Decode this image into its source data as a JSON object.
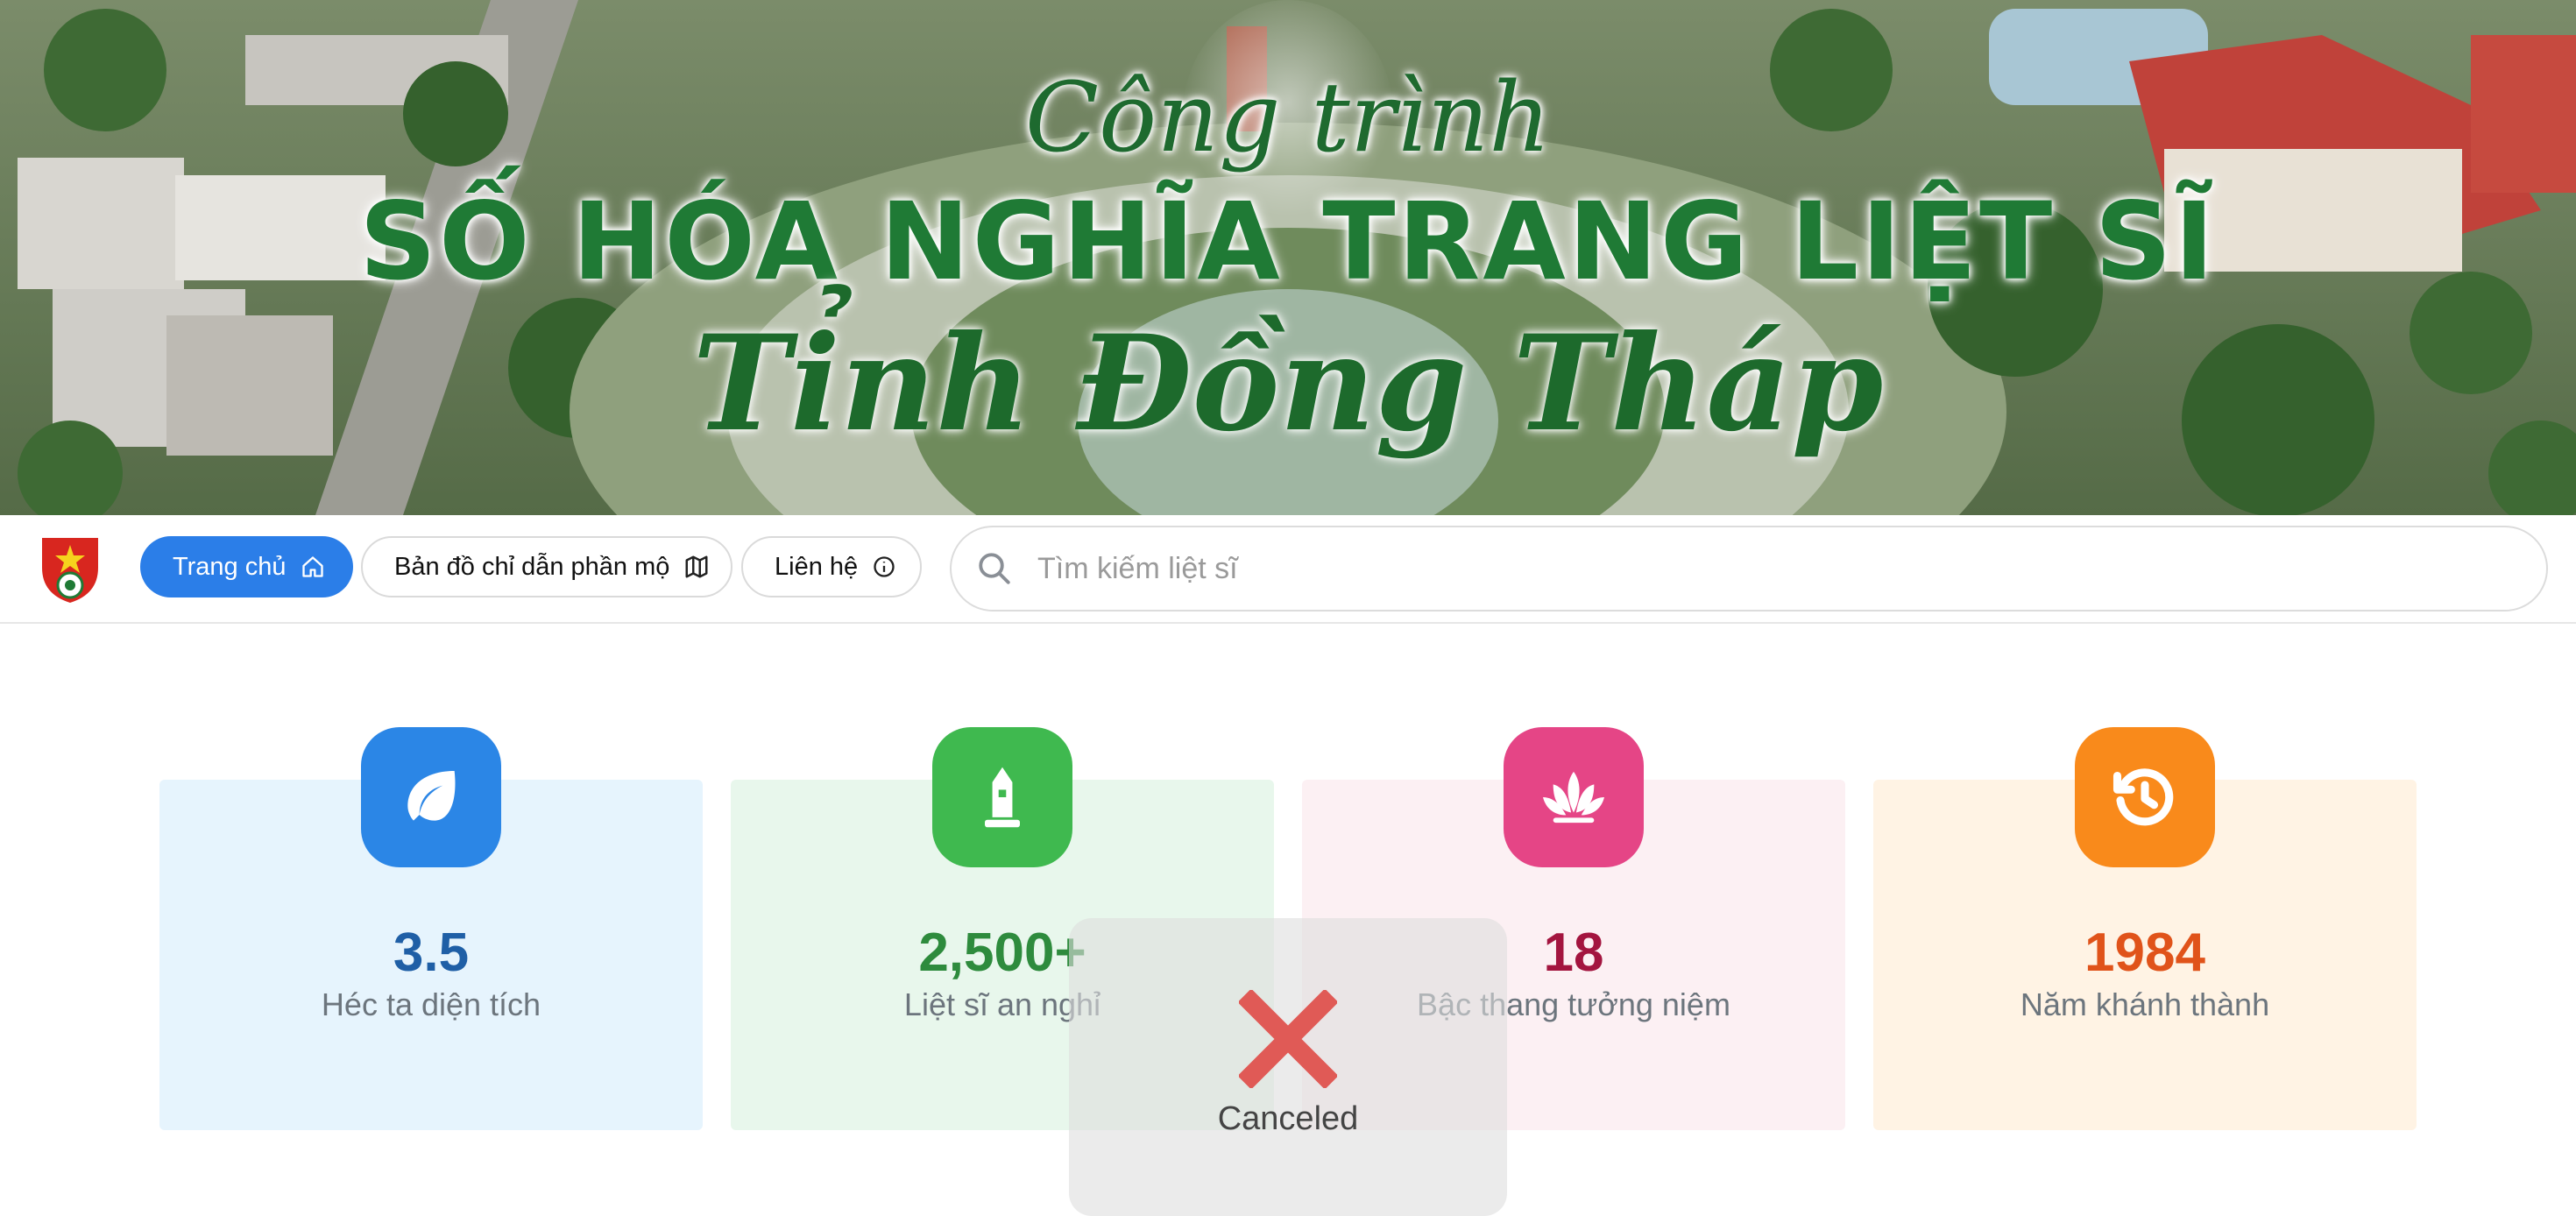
{
  "banner": {
    "subtitle": "Công trình",
    "title": "SỐ HÓA NGHĨA TRANG LIỆT SĨ",
    "province": "Tỉnh Đồng Tháp"
  },
  "navbar": {
    "logo_icon": "youth-union-emblem-icon",
    "items": [
      {
        "label": "Trang chủ",
        "icon": "home-icon",
        "active": true
      },
      {
        "label": "Bản đồ chỉ dẫn phần mộ",
        "icon": "map-icon",
        "active": false
      },
      {
        "label": "Liên hệ",
        "icon": "info-icon",
        "active": false
      }
    ],
    "search": {
      "placeholder": "Tìm kiếm liệt sĩ",
      "value": "",
      "icon": "search-icon"
    }
  },
  "stats": [
    {
      "value": "3.5",
      "label": "Héc ta diện tích",
      "icon": "leaf-icon",
      "color": "#1f5fa6",
      "icon_bg": "#2b86e6",
      "card_bg": "#e6f4fd"
    },
    {
      "value": "2,500+",
      "label": "Liệt sĩ an nghỉ",
      "icon": "monument-icon",
      "color": "#2e8b3d",
      "icon_bg": "#3fb94f",
      "card_bg": "#e8f7ec"
    },
    {
      "value": "18",
      "label": "Bậc thang tưởng niệm",
      "icon": "lotus-icon",
      "color": "#a3153f",
      "icon_bg": "#e54586",
      "card_bg": "#fcf0f3"
    },
    {
      "value": "1984",
      "label": "Năm khánh thành",
      "icon": "history-icon",
      "color": "#e0531a",
      "icon_bg": "#f98a1b",
      "card_bg": "#fff3e4"
    }
  ],
  "overlay": {
    "icon": "cross-icon",
    "text": "Canceled"
  }
}
